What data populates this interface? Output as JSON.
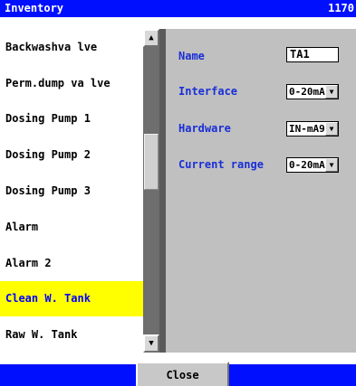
{
  "window": {
    "title": "Inventory",
    "counter": "1170"
  },
  "list": {
    "items": [
      {
        "label": "Backwashva lve"
      },
      {
        "label": "Perm.dump va lve"
      },
      {
        "label": "Dosing Pump 1"
      },
      {
        "label": "Dosing Pump 2"
      },
      {
        "label": "Dosing Pump 3"
      },
      {
        "label": "Alarm"
      },
      {
        "label": "Alarm 2"
      },
      {
        "label": "Clean W. Tank"
      },
      {
        "label": "Raw W. Tank"
      }
    ],
    "selected_label": "Clean W. Tank"
  },
  "form": {
    "name_label": "Name",
    "name_value": "TA1",
    "interface_label": "Interface",
    "interface_value": "0-20mA",
    "hardware_label": "Hardware",
    "hardware_value": "IN-mA9",
    "current_range_label": "Current range",
    "current_range_value": "0-20mA"
  },
  "footer": {
    "close_label": "Close"
  },
  "icons": {
    "scroll_up": "arrow-up-icon",
    "scroll_down": "arrow-down-icon",
    "dropdown": "chevron-down-icon"
  },
  "colors": {
    "titlebar": "#0010ff",
    "selected_bg": "#ffff00",
    "label_text": "#1a2fd6",
    "panel_bg": "#c0c0c0"
  }
}
